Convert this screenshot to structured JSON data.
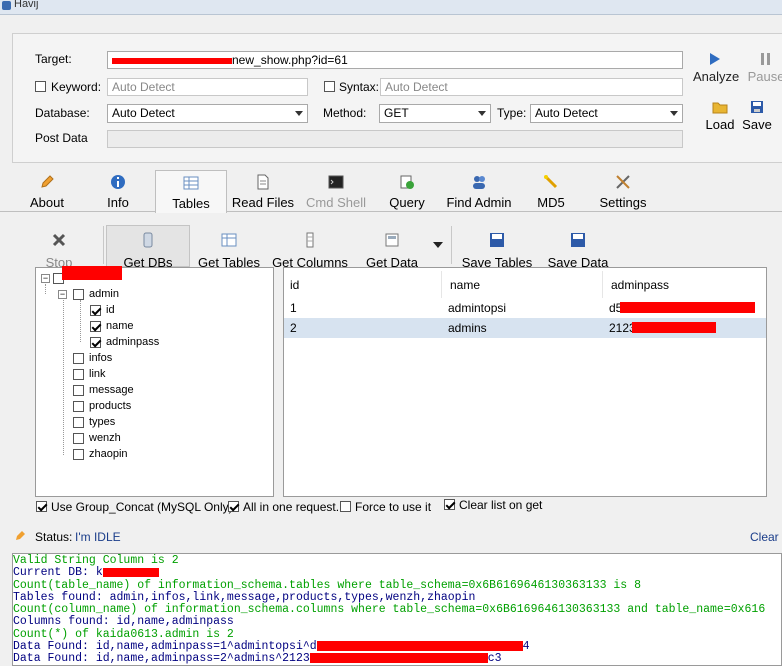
{
  "window": {
    "title": "Havij"
  },
  "target": {
    "label": "Target:",
    "value": "http://www.xxxxxx.com/new_show.php?id=61",
    "visible_suffix": "new_show.php?id=61"
  },
  "keyword": {
    "label": "Keyword:",
    "placeholder": "Auto Detect",
    "checked": false
  },
  "syntax": {
    "label": "Syntax:",
    "placeholder": "Auto Detect",
    "checked": false
  },
  "database": {
    "label": "Database:",
    "value": "Auto Detect"
  },
  "method": {
    "label": "Method:",
    "value": "GET"
  },
  "type": {
    "label": "Type:",
    "value": "Auto Detect"
  },
  "post_data": {
    "label": "Post Data"
  },
  "actions": {
    "analyze": "Analyze",
    "pause": "Pause",
    "load": "Load",
    "save": "Save"
  },
  "tabs": [
    {
      "label": "About",
      "icon": "pencil-icon"
    },
    {
      "label": "Info",
      "icon": "info-icon"
    },
    {
      "label": "Tables",
      "icon": "table-icon",
      "active": true
    },
    {
      "label": "Read Files",
      "icon": "document-icon"
    },
    {
      "label": "Cmd Shell",
      "icon": "console-icon",
      "disabled": true
    },
    {
      "label": "Query",
      "icon": "query-icon"
    },
    {
      "label": "Find Admin",
      "icon": "users-icon"
    },
    {
      "label": "MD5",
      "icon": "wand-icon"
    },
    {
      "label": "Settings",
      "icon": "tools-icon"
    }
  ],
  "toolbar": {
    "stop": "Stop",
    "get_dbs": "Get DBs",
    "get_tables": "Get Tables",
    "get_columns": "Get Columns",
    "get_data": "Get Data",
    "save_tables": "Save Tables",
    "save_data": "Save Data"
  },
  "tree": {
    "root_hidden": true,
    "table": "admin",
    "columns": [
      {
        "name": "id",
        "checked": true
      },
      {
        "name": "name",
        "checked": true
      },
      {
        "name": "adminpass",
        "checked": true
      }
    ],
    "tables": [
      "infos",
      "link",
      "message",
      "products",
      "types",
      "wenzh",
      "zhaopin"
    ]
  },
  "grid": {
    "headers": [
      "id",
      "name",
      "adminpass"
    ],
    "rows": [
      [
        "1",
        "admintopsi",
        "d5…"
      ],
      [
        "2",
        "admins",
        "2123…43894…"
      ]
    ]
  },
  "options": {
    "group_concat": {
      "label": "Use Group_Concat (MySQL Only)",
      "checked": true
    },
    "all_in_one": {
      "label": "All in one request.",
      "checked": true
    },
    "force": {
      "label": "Force to use it",
      "checked": false
    },
    "clear_list": {
      "label": "Clear list on get",
      "checked": true
    }
  },
  "status": {
    "label": "Status:",
    "value": "I'm IDLE",
    "clear_log": "Clear L"
  },
  "console": [
    {
      "text": "Valid String Column is 2",
      "color": "green"
    },
    {
      "text": "Current DB: k",
      "color": "navy"
    },
    {
      "text": "Count(table_name) of information_schema.tables where table_schema=0x6B6169646130363133 is 8",
      "color": "green"
    },
    {
      "text": "Tables found: admin,infos,link,message,products,types,wenzh,zhaopin",
      "color": "navy"
    },
    {
      "text": "Count(column_name) of information_schema.columns where table_schema=0x6B6169646130363133 and table_name=0x616",
      "color": "green"
    },
    {
      "text": "Columns found: id,name,adminpass",
      "color": "navy"
    },
    {
      "text": "Count(*) of kaida0613.admin is 2",
      "color": "green"
    },
    {
      "text": "Data Found: id,name,adminpass=1^admintopsi^d",
      "color": "navy",
      "tail": "4"
    },
    {
      "text": "Data Found: id,name,adminpass=2^admins^2123",
      "color": "navy",
      "tail": "c3"
    }
  ]
}
